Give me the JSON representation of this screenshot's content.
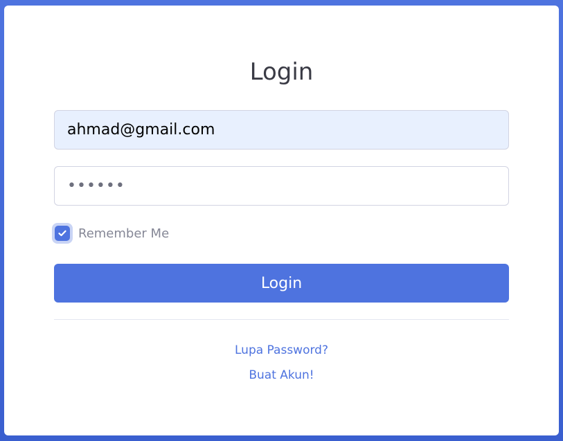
{
  "login": {
    "title": "Login",
    "email_value": "ahmad@gmail.com",
    "password_value": "••••••",
    "remember_label": "Remember Me",
    "remember_checked": true,
    "submit_label": "Login",
    "forgot_link": "Lupa Password?",
    "create_link": "Buat Akun!"
  },
  "colors": {
    "primary": "#4e73df",
    "autofill_bg": "#e8f0fe",
    "text_dark": "#3a3b45",
    "text_muted": "#858796"
  },
  "icons": {
    "checkbox": "check-icon"
  }
}
